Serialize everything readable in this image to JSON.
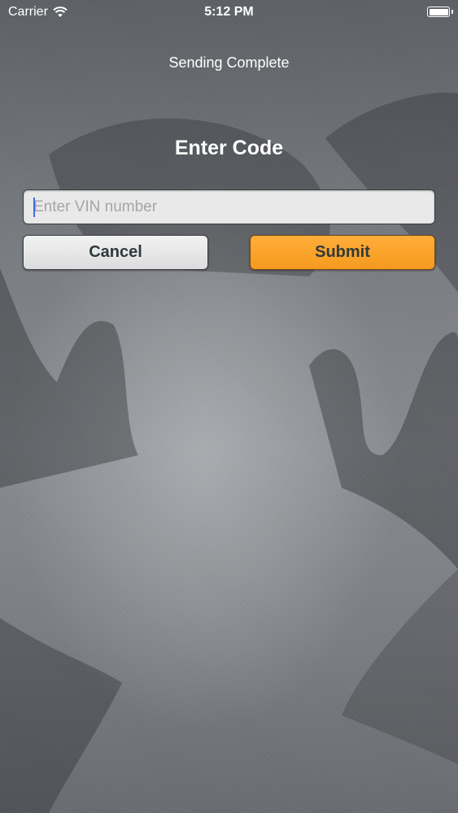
{
  "status_bar": {
    "carrier": "Carrier",
    "time": "5:12 PM",
    "wifi_icon": "wifi-icon",
    "battery_icon": "battery-icon"
  },
  "status_message": "Sending Complete",
  "title": "Enter Code",
  "vin_field": {
    "value": "",
    "placeholder": "Enter VIN number"
  },
  "buttons": {
    "cancel_label": "Cancel",
    "submit_label": "Submit"
  },
  "colors": {
    "submit": "#f7a028",
    "cancel": "#e6e6e7",
    "text_on_buttons": "#2f3a3a"
  }
}
